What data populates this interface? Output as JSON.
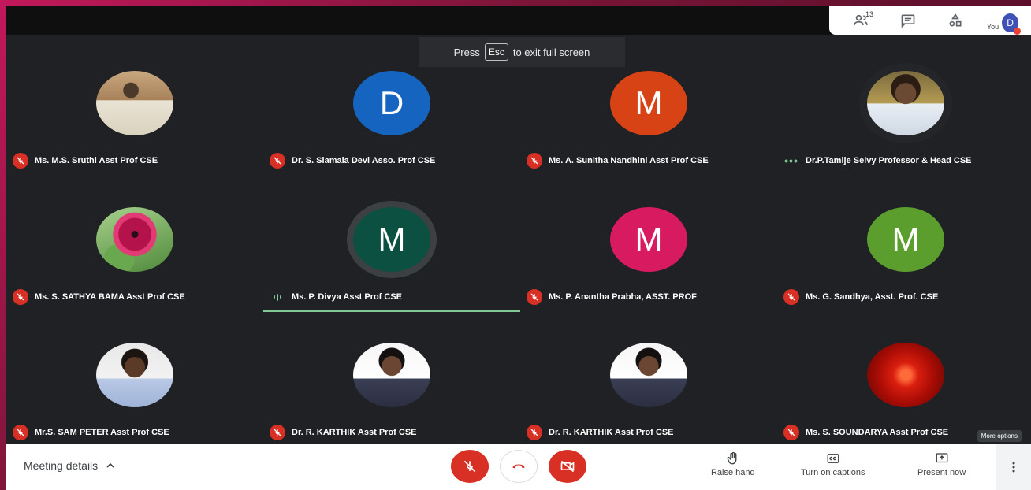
{
  "top_bar": {
    "people_count": "13",
    "you_label": "You",
    "self_initial": "D"
  },
  "toast": {
    "press": "Press",
    "key": "Esc",
    "rest": "to exit full screen"
  },
  "participants": [
    {
      "name": "Ms. M.S. Sruthi Asst Prof CSE",
      "avatar": "photo",
      "status": "muted"
    },
    {
      "name": "Dr. S. Siamala Devi Asso. Prof CSE",
      "avatar": "D",
      "color": "#1565c0",
      "status": "muted"
    },
    {
      "name": "Ms. A. Sunitha Nandhini Asst Prof CSE",
      "avatar": "M",
      "color": "#d84315",
      "status": "muted"
    },
    {
      "name": "Dr.P.Tamije Selvy Professor & Head CSE",
      "avatar": "photo",
      "status": "more"
    },
    {
      "name": "Ms. S. SATHYA BAMA Asst Prof CSE",
      "avatar": "photo",
      "status": "muted"
    },
    {
      "name": "Ms. P. Divya Asst Prof CSE",
      "avatar": "M",
      "color": "#0b5040",
      "status": "speaking"
    },
    {
      "name": "Ms. P. Anantha Prabha, ASST. PROF",
      "avatar": "M",
      "color": "#d81b60",
      "status": "muted"
    },
    {
      "name": "Ms. G. Sandhya, Asst. Prof. CSE",
      "avatar": "M",
      "color": "#5b9e2e",
      "status": "muted"
    },
    {
      "name": "Mr.S. SAM PETER Asst Prof CSE",
      "avatar": "photo",
      "status": "muted"
    },
    {
      "name": "Dr. R. KARTHIK Asst Prof CSE",
      "avatar": "photo",
      "status": "muted"
    },
    {
      "name": "Dr. R. KARTHIK Asst Prof CSE",
      "avatar": "photo",
      "status": "muted"
    },
    {
      "name": "Ms. S. SOUNDARYA Asst Prof CSE",
      "avatar": "photo",
      "status": "muted"
    }
  ],
  "tooltip": "More options",
  "bottom_bar": {
    "meeting_details": "Meeting details",
    "raise_hand": "Raise hand",
    "captions": "Turn on captions",
    "present_now": "Present now"
  },
  "colors": {
    "muted_red": "#d93025",
    "speaking_green": "#81c995",
    "background": "#202124"
  }
}
